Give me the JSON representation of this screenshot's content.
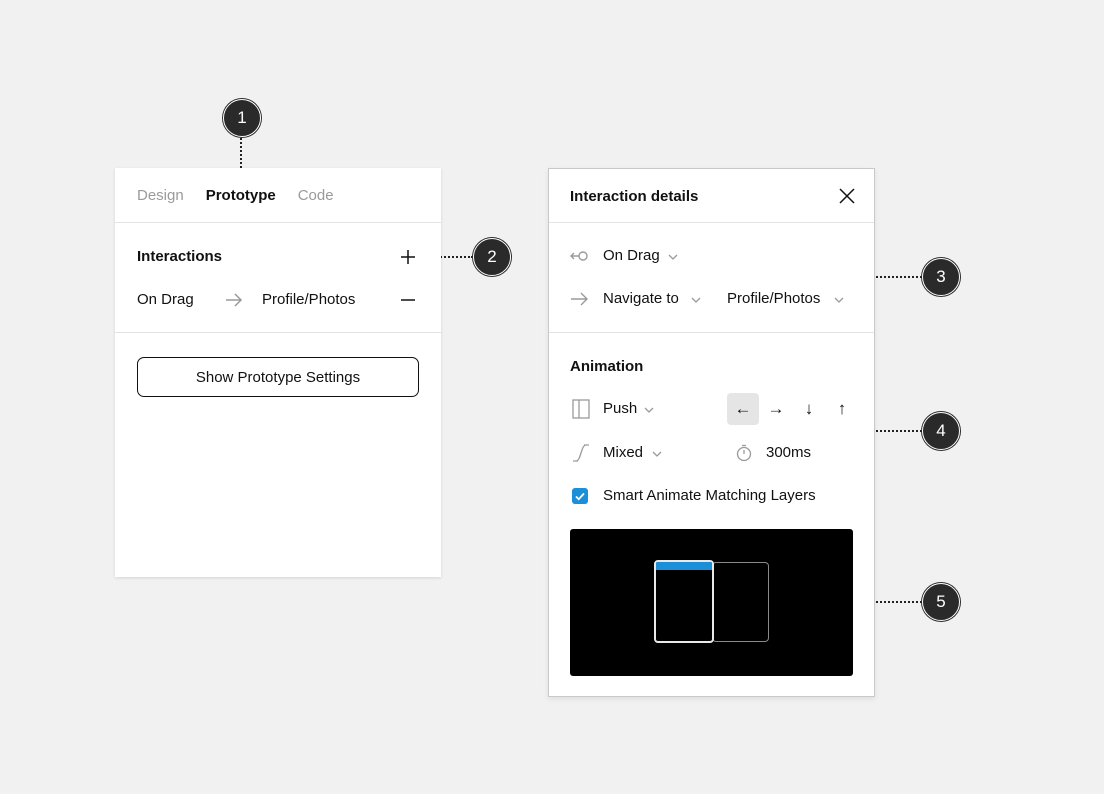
{
  "markers": [
    "1",
    "2",
    "3",
    "4",
    "5"
  ],
  "left_panel": {
    "tabs": [
      {
        "label": "Design",
        "active": false
      },
      {
        "label": "Prototype",
        "active": true
      },
      {
        "label": "Code",
        "active": false
      }
    ],
    "interactions_title": "Interactions",
    "interaction": {
      "trigger": "On Drag",
      "destination": "Profile/Photos"
    },
    "settings_button": "Show Prototype Settings"
  },
  "right_panel": {
    "title": "Interaction details",
    "trigger": "On Drag",
    "action": "Navigate to",
    "destination": "Profile/Photos",
    "animation_title": "Animation",
    "animation_type": "Push",
    "easing": "Mixed",
    "duration": "300ms",
    "directions": [
      {
        "name": "left",
        "glyph": "←",
        "selected": true
      },
      {
        "name": "right",
        "glyph": "→",
        "selected": false
      },
      {
        "name": "down",
        "glyph": "↓",
        "selected": false
      },
      {
        "name": "up",
        "glyph": "↑",
        "selected": false
      }
    ],
    "smart_animate_label": "Smart Animate Matching Layers",
    "smart_animate_checked": true
  },
  "icons": {
    "plus": "plus-icon",
    "minus": "minus-icon",
    "arrow": "arrow-right-icon",
    "close": "close-icon",
    "trigger": "drag-trigger-icon",
    "push": "push-animation-icon",
    "easing": "easing-curve-icon",
    "timer": "timer-icon",
    "check": "check-icon"
  },
  "colors": {
    "accent": "#1b8fd8",
    "marker": "#2a2a2a",
    "background": "#f1f1f1"
  }
}
